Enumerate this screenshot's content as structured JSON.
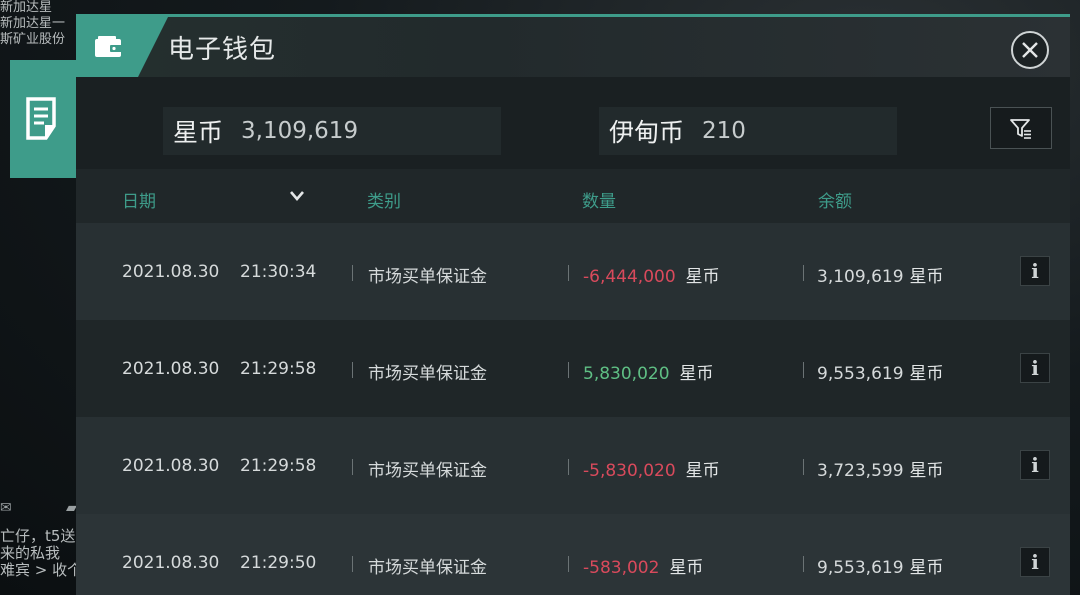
{
  "background": {
    "top_lines": [
      "新加达星",
      "新加达星一",
      "斯矿业股份"
    ],
    "bottom_lines": [
      "亡仔，t5送",
      "来的私我",
      "难宾 > 收个便宜的娜迦 有的私我"
    ]
  },
  "dialog": {
    "title": "电子钱包",
    "accent_color": "#3e9c8a",
    "balances": [
      {
        "currency": "星币",
        "amount": "3,109,619"
      },
      {
        "currency": "伊甸币",
        "amount": "210"
      }
    ],
    "columns": {
      "date": "日期",
      "category": "类别",
      "amount": "数量",
      "balance": "余额"
    },
    "rows": [
      {
        "date": "2021.08.30",
        "time": "21:30:34",
        "category": "市场买单保证金",
        "amount": "-6,444,000",
        "amount_sign": "negative",
        "amount_unit": "星币",
        "balance": "3,109,619",
        "balance_unit": "星币"
      },
      {
        "date": "2021.08.30",
        "time": "21:29:58",
        "category": "市场买单保证金",
        "amount": "5,830,020",
        "amount_sign": "positive",
        "amount_unit": "星币",
        "balance": "9,553,619",
        "balance_unit": "星币"
      },
      {
        "date": "2021.08.30",
        "time": "21:29:58",
        "category": "市场买单保证金",
        "amount": "-5,830,020",
        "amount_sign": "negative",
        "amount_unit": "星币",
        "balance": "3,723,599",
        "balance_unit": "星币"
      },
      {
        "date": "2021.08.30",
        "time": "21:29:50",
        "category": "市场买单保证金",
        "amount": "-583,002",
        "amount_sign": "negative",
        "amount_unit": "星币",
        "balance": "9,553,619",
        "balance_unit": "星币"
      }
    ],
    "info_label": "i"
  }
}
